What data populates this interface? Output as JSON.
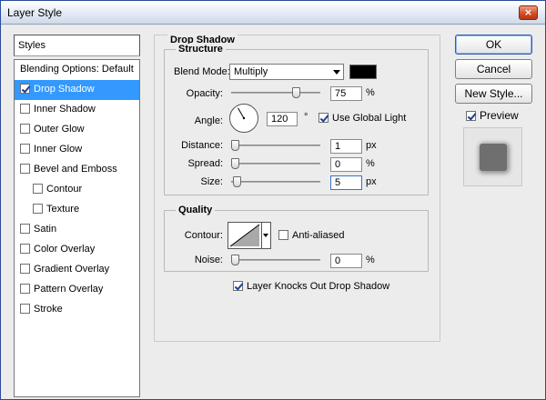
{
  "window": {
    "title": "Layer Style",
    "close_glyph": "×"
  },
  "styles": {
    "header": "Styles",
    "items": [
      {
        "label": "Blending Options: Default",
        "checkbox": false,
        "checked": false,
        "selected": false,
        "indent": false
      },
      {
        "label": "Drop Shadow",
        "checkbox": true,
        "checked": true,
        "selected": true,
        "indent": false
      },
      {
        "label": "Inner Shadow",
        "checkbox": true,
        "checked": false,
        "selected": false,
        "indent": false
      },
      {
        "label": "Outer Glow",
        "checkbox": true,
        "checked": false,
        "selected": false,
        "indent": false
      },
      {
        "label": "Inner Glow",
        "checkbox": true,
        "checked": false,
        "selected": false,
        "indent": false
      },
      {
        "label": "Bevel and Emboss",
        "checkbox": true,
        "checked": false,
        "selected": false,
        "indent": false
      },
      {
        "label": "Contour",
        "checkbox": true,
        "checked": false,
        "selected": false,
        "indent": true
      },
      {
        "label": "Texture",
        "checkbox": true,
        "checked": false,
        "selected": false,
        "indent": true
      },
      {
        "label": "Satin",
        "checkbox": true,
        "checked": false,
        "selected": false,
        "indent": false
      },
      {
        "label": "Color Overlay",
        "checkbox": true,
        "checked": false,
        "selected": false,
        "indent": false
      },
      {
        "label": "Gradient Overlay",
        "checkbox": true,
        "checked": false,
        "selected": false,
        "indent": false
      },
      {
        "label": "Pattern Overlay",
        "checkbox": true,
        "checked": false,
        "selected": false,
        "indent": false
      },
      {
        "label": "Stroke",
        "checkbox": true,
        "checked": false,
        "selected": false,
        "indent": false
      }
    ]
  },
  "drop_shadow": {
    "title": "Drop Shadow",
    "structure": {
      "title": "Structure",
      "blend_mode_label": "Blend Mode:",
      "blend_mode_value": "Multiply",
      "shadow_color": "#000000",
      "opacity_label": "Opacity:",
      "opacity_value": "75",
      "opacity_unit": "%",
      "opacity_fraction": 0.75,
      "angle_label": "Angle:",
      "angle_value": "120",
      "angle_unit": "°",
      "angle_degrees": 120,
      "use_global_light_label": "Use Global Light",
      "use_global_light": true,
      "distance_label": "Distance:",
      "distance_value": "1",
      "distance_unit": "px",
      "distance_fraction": 0.004,
      "spread_label": "Spread:",
      "spread_value": "0",
      "spread_unit": "%",
      "spread_fraction": 0.0,
      "size_label": "Size:",
      "size_value": "5",
      "size_unit": "px",
      "size_fraction": 0.02
    },
    "quality": {
      "title": "Quality",
      "contour_label": "Contour:",
      "anti_aliased_label": "Anti-aliased",
      "anti_aliased": false,
      "noise_label": "Noise:",
      "noise_value": "0",
      "noise_unit": "%",
      "noise_fraction": 0.0
    },
    "knockout_label": "Layer Knocks Out Drop Shadow",
    "knockout": true
  },
  "buttons": {
    "ok": "OK",
    "cancel": "Cancel",
    "new_style": "New Style...",
    "preview_label": "Preview",
    "preview_checked": true
  },
  "icons": {
    "close": "close-icon",
    "dropdown": "chevron-down-icon",
    "angle_dial": "angle-dial-icon",
    "contour": "contour-curve-icon"
  }
}
